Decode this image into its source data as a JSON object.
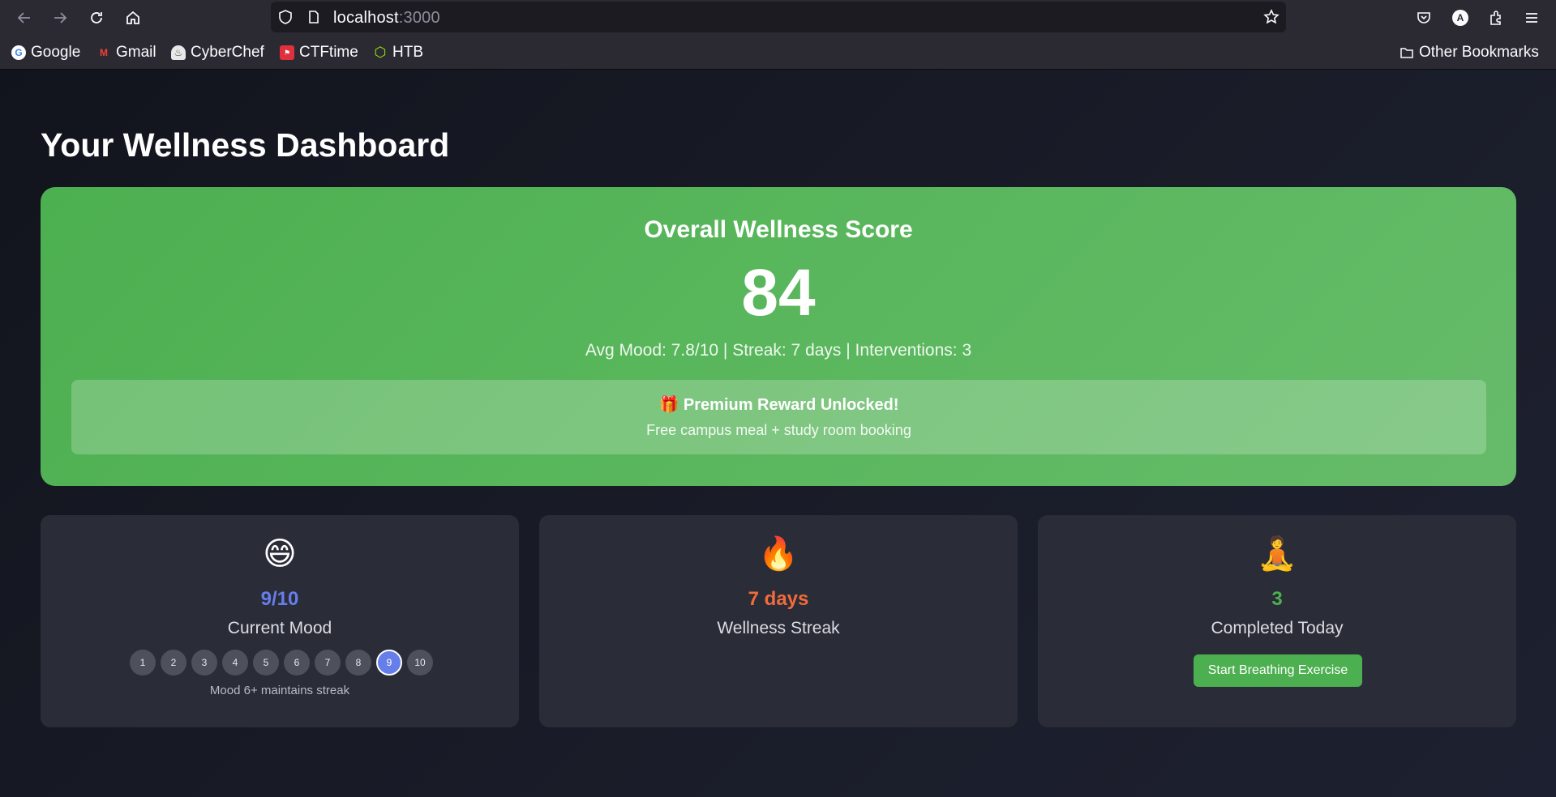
{
  "browser": {
    "url_host": "localhost",
    "url_port": ":3000",
    "bookmarks": [
      {
        "label": "Google"
      },
      {
        "label": "Gmail"
      },
      {
        "label": "CyberChef"
      },
      {
        "label": "CTFtime"
      },
      {
        "label": "HTB"
      }
    ],
    "other_bookmarks": "Other Bookmarks",
    "profile_initial": "A"
  },
  "page": {
    "title": "Your Wellness Dashboard"
  },
  "score": {
    "heading": "Overall Wellness Score",
    "value": "84",
    "stats": "Avg Mood: 7.8/10 | Streak: 7 days | Interventions: 3",
    "reward_title": "🎁 Premium Reward Unlocked!",
    "reward_sub": "Free campus meal + study room booking"
  },
  "cards": {
    "mood": {
      "emoji": "😄",
      "value": "9/10",
      "label": "Current Mood",
      "scale": [
        "1",
        "2",
        "3",
        "4",
        "5",
        "6",
        "7",
        "8",
        "9",
        "10"
      ],
      "selected": 9,
      "note": "Mood 6+ maintains streak",
      "color": "#667eea"
    },
    "streak": {
      "emoji": "🔥",
      "value": "7 days",
      "label": "Wellness Streak",
      "color": "#f26b3a"
    },
    "completed": {
      "emoji": "🧘",
      "value": "3",
      "label": "Completed Today",
      "button": "Start Breathing Exercise",
      "color": "#4caf50"
    }
  }
}
